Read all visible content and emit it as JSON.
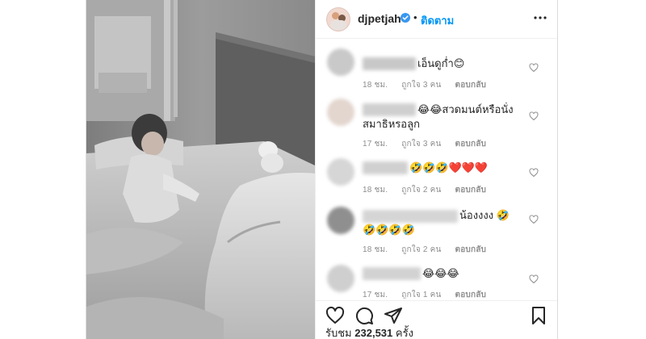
{
  "header": {
    "username": "djpetjah",
    "separator": "•",
    "follow_label": "ติดตาม"
  },
  "icons": {
    "verified": "verified-badge-icon",
    "more": "more-options-icon",
    "like": "heart-icon",
    "comment": "comment-icon",
    "share": "share-icon",
    "save": "bookmark-icon",
    "comment_like": "heart-icon"
  },
  "comments": [
    {
      "text_lines": [
        "เอ็นดูก่ำ😊"
      ],
      "time": "18 ชม.",
      "likes": "ถูกใจ 3 คน",
      "reply": "ตอบกลับ"
    },
    {
      "text_lines": [
        "😂😂สวดมนต์หรือนั่ง",
        "สมาธิหรอลูก"
      ],
      "time": "17 ชม.",
      "likes": "ถูกใจ 3 คน",
      "reply": "ตอบกลับ"
    },
    {
      "text_lines": [
        "🤣🤣🤣❤️❤️❤️"
      ],
      "time": "18 ชม.",
      "likes": "ถูกใจ 2 คน",
      "reply": "ตอบกลับ"
    },
    {
      "text_lines": [
        "น้องงงง 🤣",
        "🤣🤣🤣🤣"
      ],
      "time": "18 ชม.",
      "likes": "ถูกใจ 2 คน",
      "reply": "ตอบกลับ"
    },
    {
      "text_lines": [
        "😂😂😂"
      ],
      "time": "17 ชม.",
      "likes": "ถูกใจ 1 คน",
      "reply": "ตอบกลับ"
    }
  ],
  "footer": {
    "views_label": "รับชม",
    "views_count": "232,531",
    "views_unit": "ครั้ง"
  },
  "colors": {
    "accent": "#0095f6",
    "verified": "#3897f0",
    "meta_text": "#8e8e8e",
    "divider": "#efefef"
  }
}
